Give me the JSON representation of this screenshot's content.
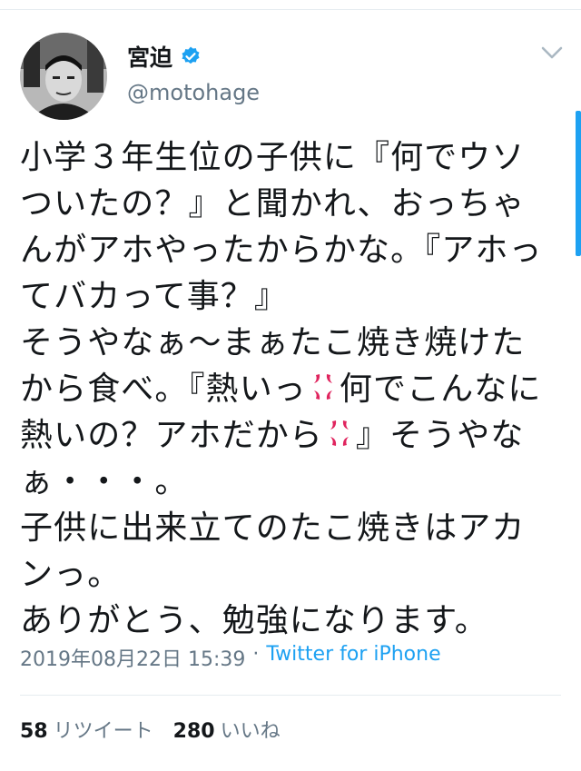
{
  "tweet": {
    "display_name": "宮迫",
    "handle": "@motohage",
    "text_segments": [
      "小学３年生位の子供に『何でウソついたの？』と聞かれ、おっちゃんがアホやったからかな。『アホってバカって事？』\nそうやなぁ〜まぁたこ焼き焼けたから食べ。『熱いっ",
      "何でこんなに熱いの？アホだから",
      "』そうやなぁ・・・。\n子供に出来立てのたこ焼きはアカンっ。\nありがとう、勉強になります。"
    ],
    "inline_icons": [
      "anger-symbol-emoji",
      "anger-symbol-emoji"
    ],
    "date": "2019年08月22日 15:39",
    "separator": "·",
    "source": "Twitter for iPhone",
    "retweets_count": "58",
    "retweets_label": "リツイート",
    "likes_count": "280",
    "likes_label": "いいね"
  },
  "icons": {
    "verified": "verified-badge-icon",
    "menu": "chevron-down-icon",
    "avatar": "avatar"
  },
  "colors": {
    "text": "#14171a",
    "secondary": "#657786",
    "accent": "#1da1f2",
    "anger": "#e0245e"
  }
}
